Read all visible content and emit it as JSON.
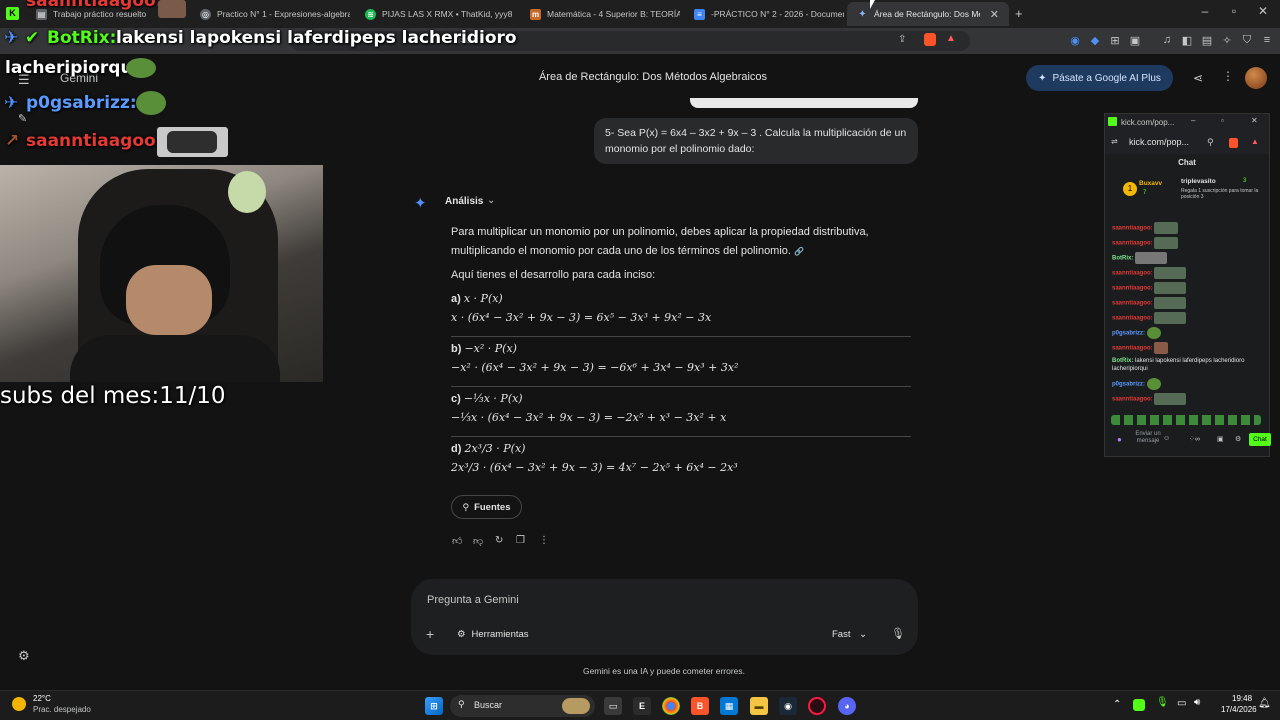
{
  "tabs": [
    {
      "label": "Trabajo práctico resuelto",
      "icon": "doc-icon"
    },
    {
      "label": "Practico N° 1 - Expresiones-algebrai",
      "icon": "globe-icon"
    },
    {
      "label": "PIJAS LAS X RMX • ThatKid, yyy8",
      "icon": "spotify-icon"
    },
    {
      "label": "Matemática - 4 Superior B: TEORÍA -",
      "icon": "classroom-icon"
    },
    {
      "label": "-PRÁCTICO N° 2 - 2026 - Documento",
      "icon": "docs-icon"
    },
    {
      "label": "Área de Rectángulo: Dos Métodos",
      "icon": "gemini-icon"
    }
  ],
  "url_fragment": "l=es",
  "gemini": {
    "brand": "Gemini",
    "page_title": "Área de Rectángulo: Dos Métodos Algebraicos",
    "upgrade_label": "Pásate a Google AI Plus",
    "user_message": "5-  Sea P(x) = 6x4 – 3x2 + 9x – 3 . Calcula la multiplicación de un monomio por el polinomio dado:",
    "analysis_label": "Análisis",
    "intro": "Para multiplicar un monomio por un polinomio, debes aplicar la propiedad distributiva, multiplicando el monomio por cada uno de los términos del polinomio.",
    "subintro": "Aquí tienes el desarrollo para cada inciso:",
    "items": [
      {
        "label": "a)",
        "head": "x · P(x)",
        "line": "x · (6x⁴ − 3x² + 9x − 3) = 6x⁵ − 3x³ + 9x² − 3x"
      },
      {
        "label": "b)",
        "head": "−x² · P(x)",
        "line": "−x² · (6x⁴ − 3x² + 9x − 3) = −6x⁶ + 3x⁴ − 9x³ + 3x²"
      },
      {
        "label": "c)",
        "head": "−⅓x · P(x)",
        "line": "−⅓x · (6x⁴ − 3x² + 9x − 3) = −2x⁵ + x³ − 3x² + x"
      },
      {
        "label": "d)",
        "head": "2x³/3 · P(x)",
        "line": "2x³/3 · (6x⁴ − 3x² + 9x − 3) = 4x⁷ − 2x⁵ + 6x⁴ − 2x³"
      }
    ],
    "sources_label": "Fuentes",
    "prompt_placeholder": "Pregunta a Gemini",
    "tools_label": "Herramientas",
    "mode_label": "Fast",
    "disclaimer": "Gemini es una IA y puede cometer errores."
  },
  "overlay": {
    "top_cut_name": "saanntiaagoo:",
    "bot_name": "BotRix:",
    "bot_message": "lakensi lapokensi laferdipeps lacheridioro",
    "bot_message_cont": "lacheripiorqui",
    "user2_name": "p0gsabrizz:",
    "user3_name": "saanntiaagoo:",
    "subs_text": "subs del mes:11/10"
  },
  "kick": {
    "window_title": "kick.com/pop...",
    "url": "kick.com/pop...",
    "chat_title": "Chat",
    "top_user": "Buxavv",
    "top_count": "7",
    "leader": "triplevasito",
    "leader_count": "3",
    "leader_note": "Regala 1 suscripción para tomar la posición 3",
    "messages": [
      {
        "name": "saanntiaagoo:",
        "type": "red"
      },
      {
        "name": "saanntiaagoo:",
        "type": "red"
      },
      {
        "name": "BotRix:",
        "type": "green"
      },
      {
        "name": "saanntiaagoo:",
        "type": "red"
      },
      {
        "name": "saanntiaagoo:",
        "type": "red"
      },
      {
        "name": "saanntiaagoo:",
        "type": "red"
      },
      {
        "name": "saanntiaagoo:",
        "type": "red"
      },
      {
        "name": "p0gsabrizz:",
        "type": "blue"
      },
      {
        "name": "saanntiaagoo:",
        "type": "red"
      },
      {
        "name": "BotRix:",
        "type": "green",
        "text": "lakensi lapokensi laferdipeps lacheridioro lacheripiorqui"
      },
      {
        "name": "p0gsabrizz:",
        "type": "blue"
      },
      {
        "name": "saanntiaagoo:",
        "type": "red"
      }
    ],
    "input_placeholder": "Enviar un mensaje",
    "send_label": "Chat"
  },
  "taskbar": {
    "weather_temp": "22°C",
    "weather_desc": "Prac. despejado",
    "search_label": "Buscar",
    "time": "19:48",
    "date": "17/4/2026"
  },
  "colors": {
    "accent": "#4f8ff7",
    "kick_green": "#53fc18",
    "chat_red": "#e53935"
  }
}
